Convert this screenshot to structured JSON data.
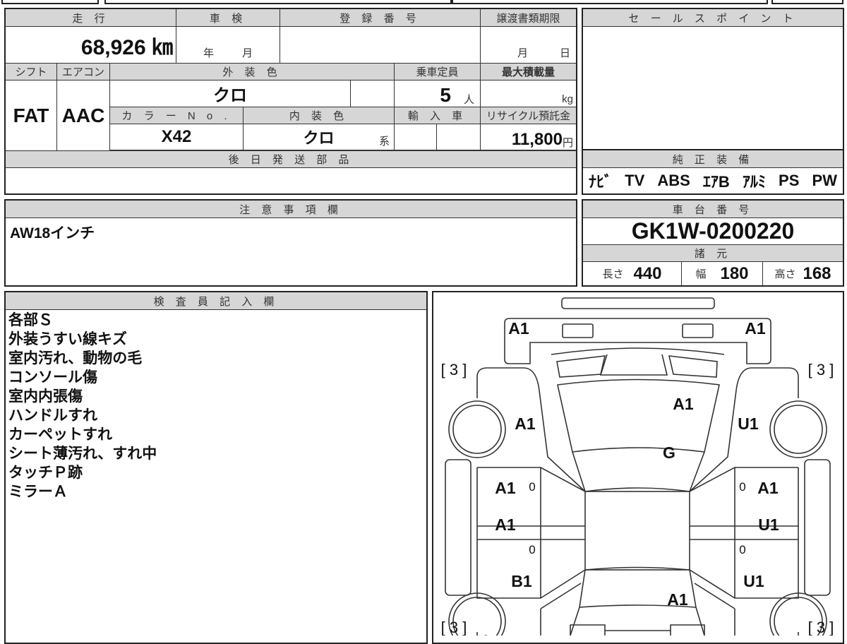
{
  "main_table": {
    "mileage_header": "走 行",
    "mileage_value": "68,926 ㎞",
    "inspection_header": "車 検",
    "inspection_year": "年",
    "inspection_month": "月",
    "registration_header": "登 録 番 号",
    "registration_value": "",
    "transfer_doc_header": "譲渡書類期限",
    "transfer_month": "月",
    "transfer_day": "日",
    "shift_header": "シフト",
    "shift_value": "FAT",
    "aircon_header": "エアコン",
    "aircon_value": "AAC",
    "exterior_color_header": "外 装 色",
    "exterior_color_value": "クロ",
    "capacity_header": "乗車定員",
    "capacity_value": "5",
    "capacity_unit": "人",
    "max_load_header": "最大積載量",
    "max_load_unit": "kg",
    "color_no_header": "カ ラ ー N o .",
    "color_no_value": "X42",
    "interior_color_header": "内 装 色",
    "interior_color_value": "クロ",
    "interior_color_suffix": "系",
    "import_header": "輸 入 車",
    "recycle_header": "リサイクル預託金",
    "recycle_value": "11,800",
    "recycle_unit": "円",
    "later_parts_header": "後 日 発 送 部 品"
  },
  "sales_point": {
    "header": "セ ー ル ス ポ イ ン ト"
  },
  "equipment": {
    "header": "純 正 装 備",
    "items": [
      "ﾅﾋﾞ",
      "TV",
      "ABS",
      "ｴｱB",
      "ｱﾙﾐ",
      "PS",
      "PW"
    ]
  },
  "caution": {
    "header": "注 意 事 項 欄",
    "text": "AW18インチ"
  },
  "chassis": {
    "header": "車 台 番 号",
    "value": "GK1W-0200220",
    "spec_header": "諸 元",
    "length_label": "長さ",
    "length": "440",
    "width_label": "幅",
    "width": "180",
    "height_label": "高さ",
    "height": "168"
  },
  "inspector": {
    "header": "検 査 員 記 入 欄",
    "notes": [
      "各部Ｓ",
      "外装うすい線キズ",
      "室内汚れ、動物の毛",
      "コンソール傷",
      "室内内張傷",
      "ハンドルすれ",
      "カーペットすれ",
      "シート薄汚れ、すれ中",
      "タッチＰ跡",
      "ミラーＡ"
    ]
  },
  "diagram": {
    "front_bumper_left": "A1",
    "front_bumper_right": "A1",
    "hood": "A1",
    "front_left_fender": "A1",
    "front_right_fender": "U1",
    "windshield": "G",
    "front_left_door": "A1",
    "front_right_door": "A1",
    "rear_left_door": "A1",
    "rear_right_door": "U1",
    "rear_left_quarter": "B1",
    "rear_right_quarter": "U1",
    "trunk": "A1",
    "tire_fl": "[ 3 ]",
    "tire_fr": "[ 3 ]",
    "tire_rl": "[ 3 ]",
    "tire_rr": "[ 3 ]",
    "mark_0": "0"
  }
}
